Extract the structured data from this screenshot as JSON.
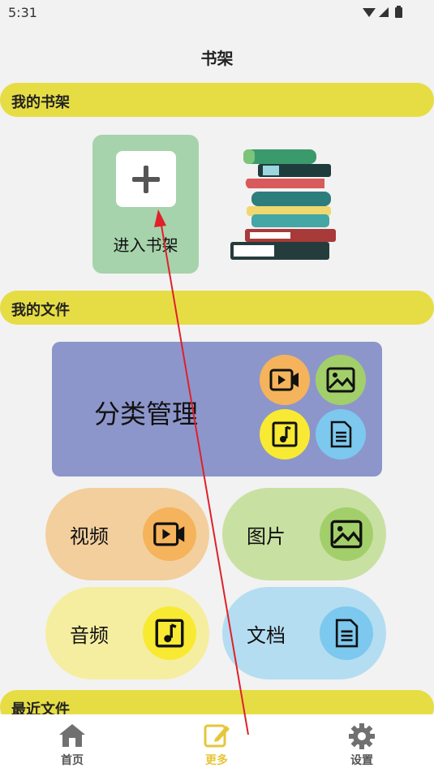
{
  "status": {
    "time": "5:31",
    "icons": "▼◢▮"
  },
  "header": {
    "title": "书架"
  },
  "sections": {
    "bookshelf": "我的书架",
    "files": "我的文件",
    "recent": "最近文件"
  },
  "bookshelf": {
    "enter_label": "进入书架"
  },
  "category": {
    "label": "分类管理"
  },
  "tiles": {
    "video": "视频",
    "image": "图片",
    "audio": "音频",
    "document": "文档"
  },
  "nav": {
    "home": "首页",
    "more": "更多",
    "settings": "设置"
  },
  "colors": {
    "accent_yellow": "#e6dd45",
    "video": "#f3cf9e",
    "image": "#c9e0a3",
    "audio": "#f5eea0",
    "document": "#b4ddf1",
    "active_nav": "#e6c63a"
  }
}
